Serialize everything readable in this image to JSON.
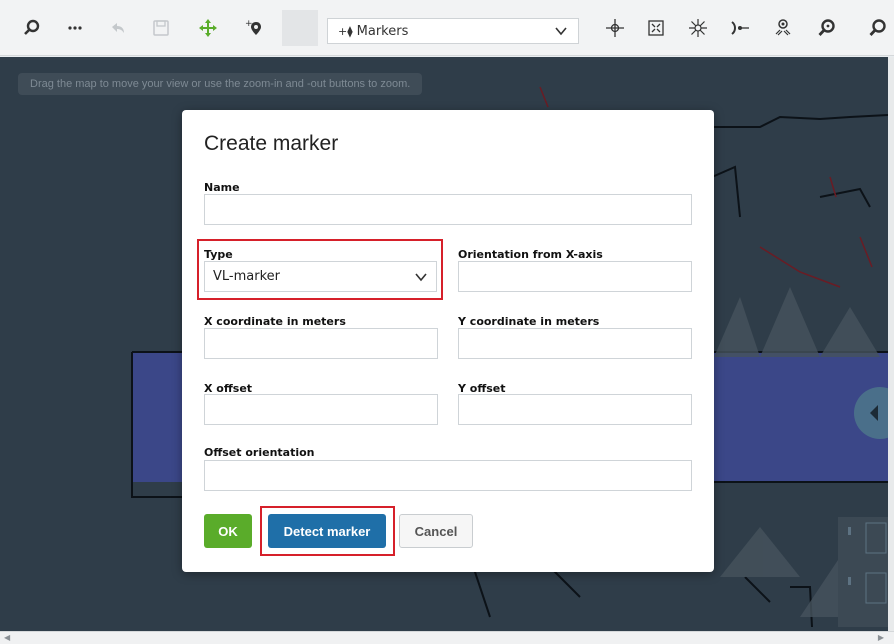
{
  "toolbar": {
    "mission_select": {
      "value": "Markers"
    },
    "buttons": [
      {
        "name": "search-icon"
      },
      {
        "name": "more-icon"
      },
      {
        "name": "undo-icon"
      },
      {
        "name": "save-icon"
      },
      {
        "name": "move-icon"
      },
      {
        "name": "add-marker-icon"
      },
      {
        "name": "crosshair-icon"
      },
      {
        "name": "fit-map-icon"
      },
      {
        "name": "sun-icon"
      },
      {
        "name": "laser-icon"
      },
      {
        "name": "robot-position-icon"
      },
      {
        "name": "zoom-in-icon"
      },
      {
        "name": "zoom-out-icon"
      }
    ]
  },
  "map": {
    "hint": "Drag the map to move your view or use the zoom-in and -out buttons to zoom."
  },
  "dialog": {
    "title": "Create marker",
    "fields": {
      "name": {
        "label": "Name",
        "value": ""
      },
      "type": {
        "label": "Type",
        "value": "VL-marker"
      },
      "orientation": {
        "label": "Orientation from X-axis",
        "value": ""
      },
      "x_coord": {
        "label": "X coordinate in meters",
        "value": ""
      },
      "y_coord": {
        "label": "Y coordinate in meters",
        "value": ""
      },
      "x_offset": {
        "label": "X offset",
        "value": ""
      },
      "y_offset": {
        "label": "Y offset",
        "value": ""
      },
      "offset_orientation": {
        "label": "Offset orientation",
        "value": ""
      }
    },
    "buttons": {
      "ok": "OK",
      "detect": "Detect marker",
      "cancel": "Cancel"
    }
  },
  "colors": {
    "ok": "#5aac2a",
    "detect": "#1f6fa8",
    "highlight": "#d6202a",
    "map_bg": "#2f3d49"
  }
}
